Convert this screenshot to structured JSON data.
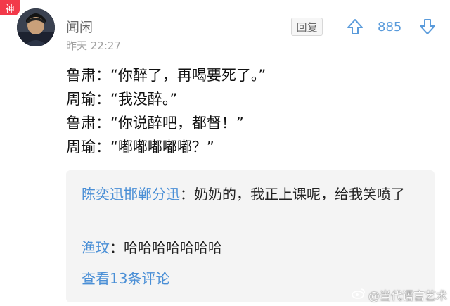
{
  "badge": "神",
  "comment": {
    "username": "闻闲",
    "timestamp": "昨天 22:27",
    "reply_label": "回复",
    "like_count": "885",
    "lines": [
      "鲁肃：“你醉了，再喝要死了。”",
      "周瑜：“我没醉。”",
      "鲁肃：“你说醉吧，都督！”",
      "周瑜：“嘟嘟嘟嘟嘟？”"
    ]
  },
  "replies": {
    "items": [
      {
        "name": "陈奕迅邯郸分迅",
        "separator": "：",
        "text": "奶奶的，我正上课呢，给我笑喷了"
      },
      {
        "name": "渔玟",
        "separator": "：",
        "text": "哈哈哈哈哈哈哈"
      }
    ],
    "view_more": "查看13条评论"
  },
  "watermark": "当代语言艺术",
  "colors": {
    "badge": "#f2394a",
    "link_blue": "#4a8fd6",
    "count_blue": "#5a9bdb",
    "muted": "#a2a2a2"
  },
  "icons": [
    "thumb-up-arrow-icon",
    "thumb-down-arrow-icon",
    "weibo-logo-icon"
  ]
}
